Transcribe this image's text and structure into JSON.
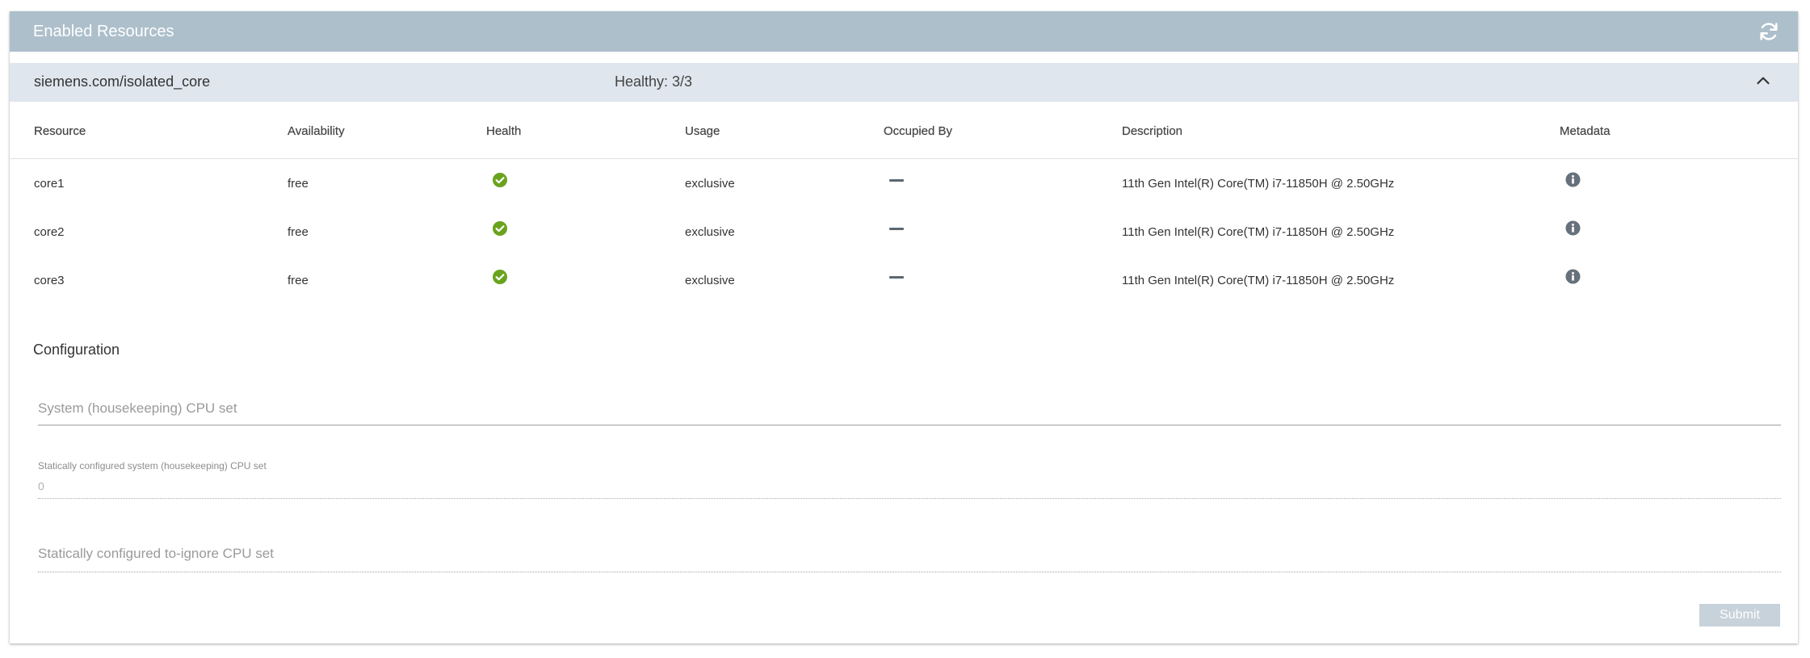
{
  "header": {
    "title": "Enabled Resources",
    "refresh_icon": "refresh-icon"
  },
  "group": {
    "name": "siemens.com/isolated_core",
    "health": "Healthy: 3/3",
    "collapse_icon": "chevron-up-icon"
  },
  "table": {
    "columns": [
      "Resource",
      "Availability",
      "Health",
      "Usage",
      "Occupied By",
      "Description",
      "Metadata"
    ],
    "rows": [
      {
        "resource": "core1",
        "availability": "free",
        "health": "healthy",
        "usage": "exclusive",
        "occupied_by": "—",
        "description": "11th Gen Intel(R) Core(TM) i7-11850H @ 2.50GHz"
      },
      {
        "resource": "core2",
        "availability": "free",
        "health": "healthy",
        "usage": "exclusive",
        "occupied_by": "—",
        "description": "11th Gen Intel(R) Core(TM) i7-11850H @ 2.50GHz"
      },
      {
        "resource": "core3",
        "availability": "free",
        "health": "healthy",
        "usage": "exclusive",
        "occupied_by": "—",
        "description": "11th Gen Intel(R) Core(TM) i7-11850H @ 2.50GHz"
      }
    ]
  },
  "configuration": {
    "title": "Configuration",
    "system_cpu_set": {
      "placeholder": "System (housekeeping) CPU set",
      "value": ""
    },
    "static_system_cpu_set": {
      "label": "Statically configured system (housekeeping) CPU set",
      "value": "0"
    },
    "static_ignore_cpu_set": {
      "placeholder": "Statically configured to-ignore CPU set",
      "value": ""
    },
    "submit_label": "Submit"
  },
  "colors": {
    "header_bg": "#adbfcb",
    "group_bg": "#dfe6ed",
    "healthy_green": "#6aa31d",
    "submit_disabled": "#c7d2da"
  }
}
